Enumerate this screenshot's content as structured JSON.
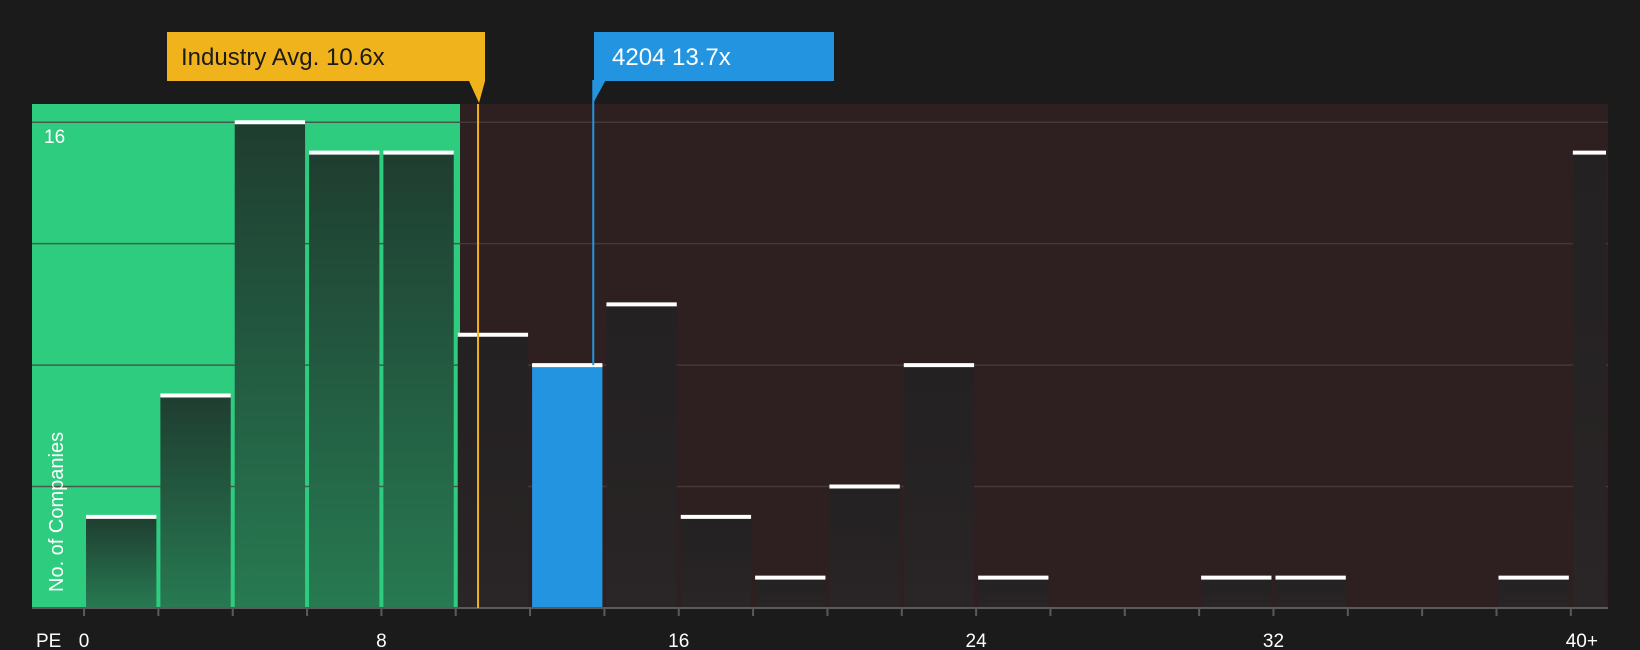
{
  "chart_data": {
    "type": "bar",
    "title": "",
    "xlabel": "PE",
    "ylabel": "No. of Companies",
    "x_ticks": [
      "0",
      "8",
      "16",
      "24",
      "32",
      "40+"
    ],
    "x_tick_values": [
      0,
      8,
      16,
      24,
      32,
      40
    ],
    "xlim": [
      -1.4,
      41
    ],
    "bin_width": 2,
    "y_tick_label": "16",
    "ylim": [
      0,
      16.6
    ],
    "grid": true,
    "bins": [
      {
        "start": 0,
        "end": 2,
        "value": 3
      },
      {
        "start": 2,
        "end": 4,
        "value": 7
      },
      {
        "start": 4,
        "end": 6,
        "value": 16
      },
      {
        "start": 6,
        "end": 8,
        "value": 15
      },
      {
        "start": 8,
        "end": 10,
        "value": 15
      },
      {
        "start": 10,
        "end": 12,
        "value": 9
      },
      {
        "start": 12,
        "end": 14,
        "value": 8,
        "highlight": true
      },
      {
        "start": 14,
        "end": 16,
        "value": 10
      },
      {
        "start": 16,
        "end": 18,
        "value": 3
      },
      {
        "start": 18,
        "end": 20,
        "value": 1
      },
      {
        "start": 20,
        "end": 22,
        "value": 4
      },
      {
        "start": 22,
        "end": 24,
        "value": 8
      },
      {
        "start": 24,
        "end": 26,
        "value": 1
      },
      {
        "start": 30,
        "end": 32,
        "value": 1
      },
      {
        "start": 32,
        "end": 34,
        "value": 1
      },
      {
        "start": 38,
        "end": 40,
        "value": 1
      },
      {
        "start": 40,
        "end": 41,
        "value": 15
      }
    ],
    "industry_avg": {
      "label": "Industry Avg. 10.6x",
      "value": 10.6
    },
    "company": {
      "label": "4204 13.7x",
      "value": 13.7
    },
    "colors": {
      "background": "#1b1b1b",
      "below_avg_zone": "#2ecc7e",
      "above_avg_zone": "#2e1f20",
      "bar_green_top": "#1f3d30",
      "bar_green_bottom": "#277a52",
      "bar_dark_top": "#232122",
      "bar_dark_bottom": "#2a2526",
      "bar_cap": "#ffffff",
      "highlight": "#2394e0",
      "industry_marker": "#f0b31b",
      "company_marker": "#2394e0",
      "grid": "#4a4040",
      "axis": "#5a5a5a"
    }
  }
}
